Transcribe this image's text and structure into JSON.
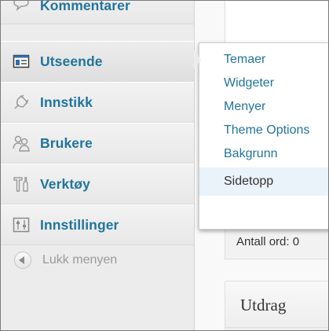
{
  "sidebar": {
    "items": [
      {
        "label": "Kommentarer",
        "icon": "comment-bubble-icon"
      },
      {
        "label": "Utseende",
        "icon": "appearance-icon"
      },
      {
        "label": "Innstikk",
        "icon": "plugin-plug-icon"
      },
      {
        "label": "Brukere",
        "icon": "users-icon"
      },
      {
        "label": "Verktøy",
        "icon": "tools-icon"
      },
      {
        "label": "Innstillinger",
        "icon": "settings-sliders-icon"
      }
    ],
    "collapse_label": "Lukk menyen"
  },
  "submenu": {
    "items": [
      {
        "label": "Temaer"
      },
      {
        "label": "Widgeter"
      },
      {
        "label": "Menyer"
      },
      {
        "label": "Theme Options"
      },
      {
        "label": "Bakgrunn"
      },
      {
        "label": "Sidetopp"
      }
    ]
  },
  "main": {
    "word_count": "Antall ord: 0",
    "excerpt_title": "Utdrag"
  },
  "colors": {
    "link": "#21759b",
    "sidebar_bg": "#ececec",
    "hover_bg": "#eaf2fa"
  }
}
